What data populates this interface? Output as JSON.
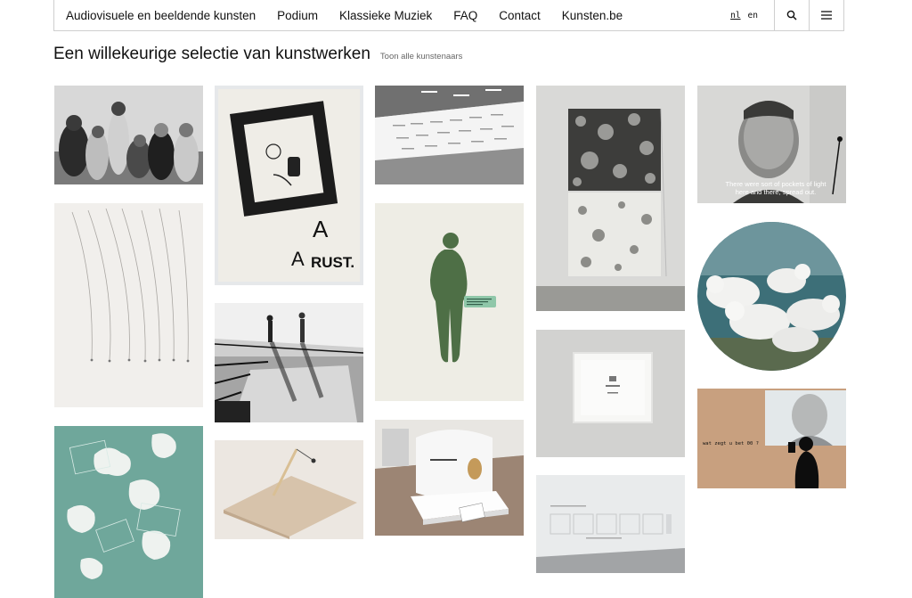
{
  "nav": {
    "links": [
      "Audiovisuele en beeldende kunsten",
      "Podium",
      "Klassieke Muziek",
      "FAQ",
      "Contact",
      "Kunsten.be"
    ],
    "languages": [
      "nl",
      "en"
    ],
    "active_language": "nl",
    "search_icon": "search-icon",
    "menu_icon": "hamburger-menu-icon"
  },
  "page": {
    "title": "Een willekeurige selectie van kunstwerken",
    "show_all_link": "Toon alle kunstenaars"
  },
  "artworks": {
    "rust_text_a1": "A",
    "rust_text_a2": "A",
    "rust_text_word": "RUST.",
    "video_subtitle_line1": "There were sort of pockets of light",
    "video_subtitle_line2": "here and there, spread out.",
    "projection_text": "wat zegt u bet 00 ?"
  }
}
